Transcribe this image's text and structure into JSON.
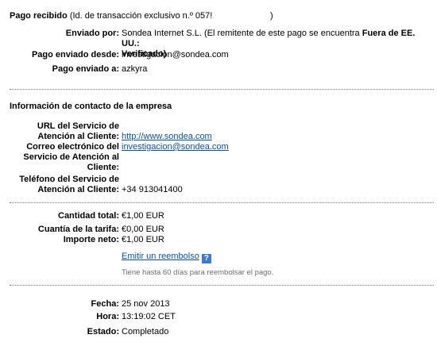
{
  "receipt": {
    "title": "Pago recibido",
    "transaction_note": "(Id. de transacción exclusivo n.º 057!",
    "transaction_close": ")"
  },
  "sender": {
    "sent_by_label": "Enviado por:",
    "sent_by_name": "Sondea Internet S.L.",
    "sent_by_note_prefix": "(El remitente de este pago se encuentra",
    "sent_by_note_bold": "Fuera de EE. UU.:",
    "sent_by_note_line2": "Verificado)",
    "sent_from_label": "Pago enviado desde:",
    "sent_from_value": "investigacion@sondea.com",
    "sent_to_label": "Pago enviado a:",
    "sent_to_value": "azkyra"
  },
  "company": {
    "heading": "Información de contacto de la empresa",
    "url_label_1": "URL del Servicio de",
    "url_label_2": "Atención al Cliente:",
    "url_value": "http://www.sondea.com",
    "email_label_1": "Correo electrónico del",
    "email_label_2": "Servicio de Atención al",
    "email_label_3": "Cliente:",
    "email_value": "investigacion@sondea.com",
    "phone_label_1": "Teléfono del Servicio de",
    "phone_label_2": "Atención al Cliente:",
    "phone_value": "+34 913041400"
  },
  "amounts": {
    "total_label": "Cantidad total:",
    "total_value": "€1,00 EUR",
    "fee_label": "Cuantía de la tarifa:",
    "fee_value": "€0,00 EUR",
    "net_label": "Importe neto:",
    "net_value": "€1,00 EUR",
    "refund_link": "Emitir un reembolso",
    "help_glyph": "?",
    "refund_note": "Tiene hasta 60 días para reembolsar el pago."
  },
  "status": {
    "date_label": "Fecha:",
    "date_value": "25 nov 2013",
    "time_label": "Hora:",
    "time_value": "13:19:02 CET",
    "state_label": "Estado:",
    "state_value": "Completado"
  }
}
